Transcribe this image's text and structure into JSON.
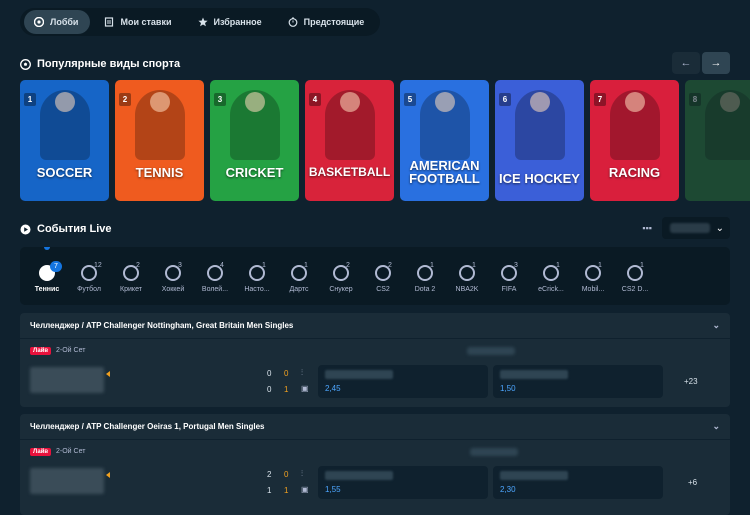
{
  "nav": {
    "tabs": [
      {
        "label": "Лобби",
        "icon": "chip-icon",
        "active": true
      },
      {
        "label": "Мои ставки",
        "icon": "receipt-icon",
        "active": false
      },
      {
        "label": "Избранное",
        "icon": "star-icon",
        "active": false
      },
      {
        "label": "Предстоящие",
        "icon": "clock-icon",
        "active": false
      }
    ]
  },
  "popular": {
    "title": "Популярные виды спорта",
    "prev_icon": "←",
    "next_icon": "→",
    "cards": [
      {
        "num": "1",
        "name": "SOCCER",
        "bg": "#1665c7"
      },
      {
        "num": "2",
        "name": "TENNIS",
        "bg": "#ef5b1f"
      },
      {
        "num": "3",
        "name": "CRICKET",
        "bg": "#25a244"
      },
      {
        "num": "4",
        "name": "BASKETBALL",
        "bg": "#d8233a"
      },
      {
        "num": "5",
        "name": "AMERICAN FOOTBALL",
        "bg": "#2970e0"
      },
      {
        "num": "6",
        "name": "ICE HOCKEY",
        "bg": "#3b5fd8"
      },
      {
        "num": "7",
        "name": "RACING",
        "bg": "#d91f3c"
      },
      {
        "num": "8",
        "name": "",
        "bg": "#2f7a3a"
      }
    ]
  },
  "live": {
    "title": "События Live",
    "dropdown_chev": "⌄",
    "grid_icon": "▪▪▪"
  },
  "sports": [
    {
      "label": "Теннис",
      "count": "7",
      "active": true
    },
    {
      "label": "Футбол",
      "count": "12",
      "active": false
    },
    {
      "label": "Крикет",
      "count": "2",
      "active": false
    },
    {
      "label": "Хоккей",
      "count": "3",
      "active": false
    },
    {
      "label": "Волей...",
      "count": "4",
      "active": false
    },
    {
      "label": "Насто...",
      "count": "1",
      "active": false
    },
    {
      "label": "Дартс",
      "count": "1",
      "active": false
    },
    {
      "label": "Снукер",
      "count": "2",
      "active": false
    },
    {
      "label": "CS2",
      "count": "2",
      "active": false
    },
    {
      "label": "Dota 2",
      "count": "1",
      "active": false
    },
    {
      "label": "NBA2K",
      "count": "1",
      "active": false
    },
    {
      "label": "FIFA",
      "count": "3",
      "active": false
    },
    {
      "label": "eCrick...",
      "count": "1",
      "active": false
    },
    {
      "label": "Mobil...",
      "count": "1",
      "active": false
    },
    {
      "label": "CS2 D...",
      "count": "1",
      "active": false
    }
  ],
  "events": [
    {
      "title": "Челленджер / ATP Challenger Nottingham, Great Britain Men Singles",
      "badge": "Лайв",
      "set": "2-Ой Сет",
      "score1": [
        "0",
        "0"
      ],
      "score2": [
        "0",
        "1"
      ],
      "odd1": "2,45",
      "odd2": "1,50",
      "more": "+23"
    },
    {
      "title": "Челленджер / ATP Challenger Oeiras 1, Portugal Men Singles",
      "badge": "Лайв",
      "set": "2-Ой Сет",
      "score1": [
        "2",
        "0"
      ],
      "score2": [
        "1",
        "1"
      ],
      "odd1": "1,55",
      "odd2": "2,30",
      "more": "+6"
    }
  ],
  "colors": {
    "bg": "#0f212e",
    "panel": "#1a2c38",
    "accent": "#1475e1",
    "live": "#e9113c",
    "odds": "#4da6ff"
  }
}
